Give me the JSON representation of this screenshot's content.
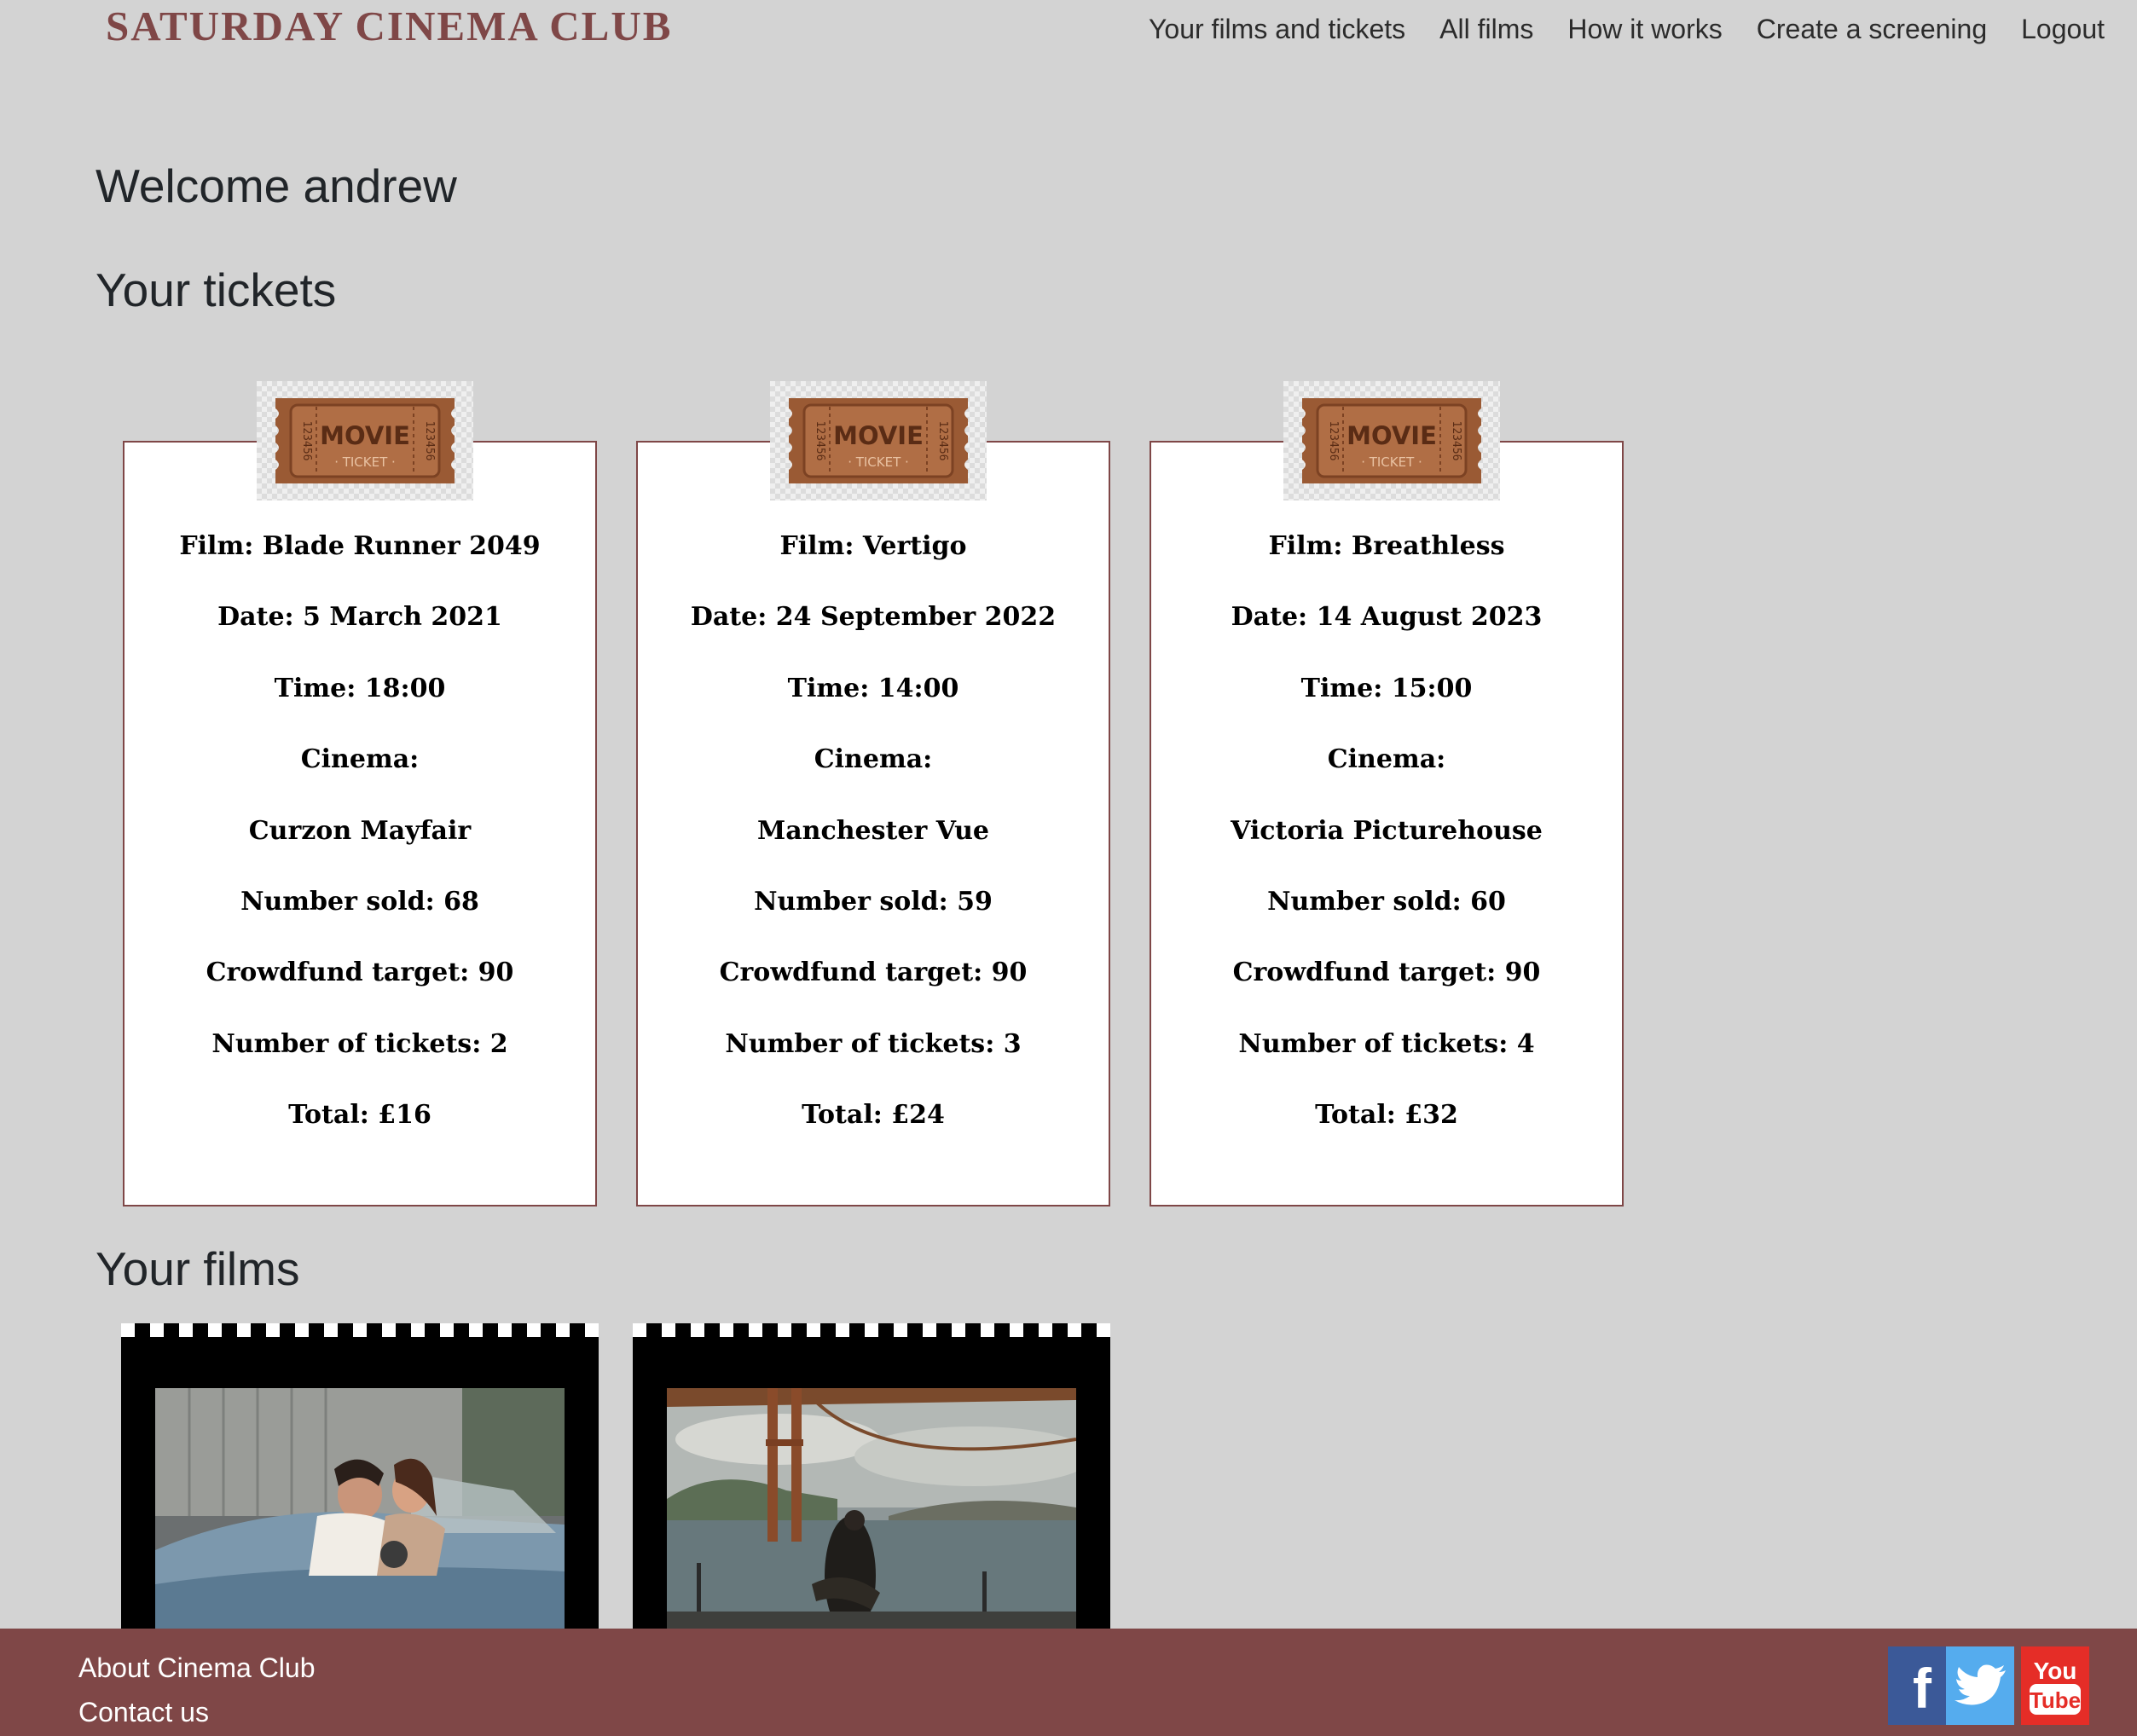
{
  "header": {
    "brand": "SATURDAY CINEMA CLUB",
    "nav": [
      {
        "label": "Your films and tickets",
        "name": "nav-your-films-and-tickets"
      },
      {
        "label": "All films",
        "name": "nav-all-films"
      },
      {
        "label": "How it works",
        "name": "nav-how-it-works"
      },
      {
        "label": "Create a screening",
        "name": "nav-create-a-screening"
      },
      {
        "label": "Logout",
        "name": "nav-logout"
      }
    ]
  },
  "main": {
    "welcome": "Welcome andrew",
    "tickets_title": "Your tickets",
    "films_title": "Your films",
    "ticket_badge": {
      "line1": "MOVIE",
      "line2": "· TICKET ·",
      "serial": "123456"
    },
    "tickets": [
      {
        "fields": [
          "Film: Blade Runner 2049",
          "Date: 5 March 2021",
          "Time: 18:00",
          "Cinema:",
          "Curzon Mayfair",
          "Number sold: 68",
          "Crowdfund target: 90",
          "Number of tickets: 2",
          "Total: £16"
        ]
      },
      {
        "fields": [
          "Film: Vertigo",
          "Date: 24 September 2022",
          "Time: 14:00",
          "Cinema:",
          "Manchester Vue",
          "Number sold: 59",
          "Crowdfund target: 90",
          "Number of tickets: 3",
          "Total: £24"
        ]
      },
      {
        "fields": [
          "Film: Breathless",
          "Date: 14 August 2023",
          "Time: 15:00",
          "Cinema:",
          "Victoria Picturehouse",
          "Number sold: 60",
          "Crowdfund target: 90",
          "Number of tickets: 4",
          "Total: £32"
        ]
      }
    ],
    "films": [
      {
        "still": "film-still-couple-in-convertible"
      },
      {
        "still": "film-still-golden-gate-bridge"
      }
    ]
  },
  "footer": {
    "about": "About Cinema Club",
    "contact": "Contact us",
    "social": [
      {
        "name": "facebook-icon",
        "glyph": "f",
        "color": "#3b5998"
      },
      {
        "name": "twitter-icon",
        "color": "#55acee"
      },
      {
        "name": "youtube-icon",
        "glyph_top": "You",
        "glyph_bottom": "Tube",
        "color": "#e52d27"
      }
    ]
  },
  "colors": {
    "background": "#d3d3d3",
    "accent": "#7f4747",
    "card": "#ffffff"
  }
}
